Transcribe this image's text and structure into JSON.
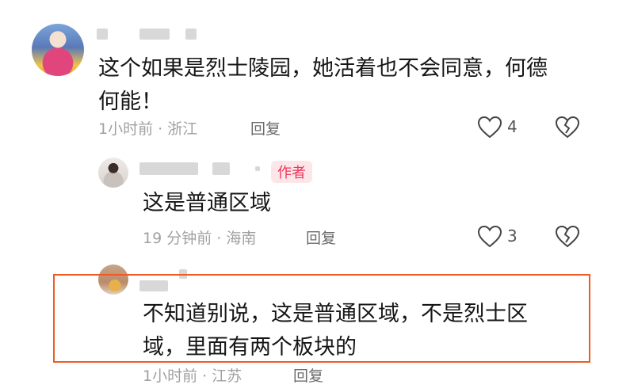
{
  "comments": [
    {
      "text_line1": "这个如果是烈士陵园，她活着也不会同意，何德",
      "text_line2": "何能！",
      "meta": "1小时前 · 浙江",
      "reply_label": "回复",
      "likes": "4"
    },
    {
      "tag": "作者",
      "text": "这是普通区域",
      "meta": "19 分钟前 · 海南",
      "reply_label": "回复",
      "likes": "3"
    },
    {
      "text_line1": "不知道别说，这是普通区域，不是烈士区",
      "text_line2": "域，里面有两个板块的",
      "meta": "1小时前 · 江苏",
      "reply_label": "回复"
    }
  ],
  "icons": {
    "like": "heart-outline-icon",
    "dislike": "broken-heart-icon"
  },
  "colors": {
    "highlight_border": "#f05a23",
    "author_tag_bg": "#fde6ea",
    "author_tag_text": "#f0355b"
  }
}
